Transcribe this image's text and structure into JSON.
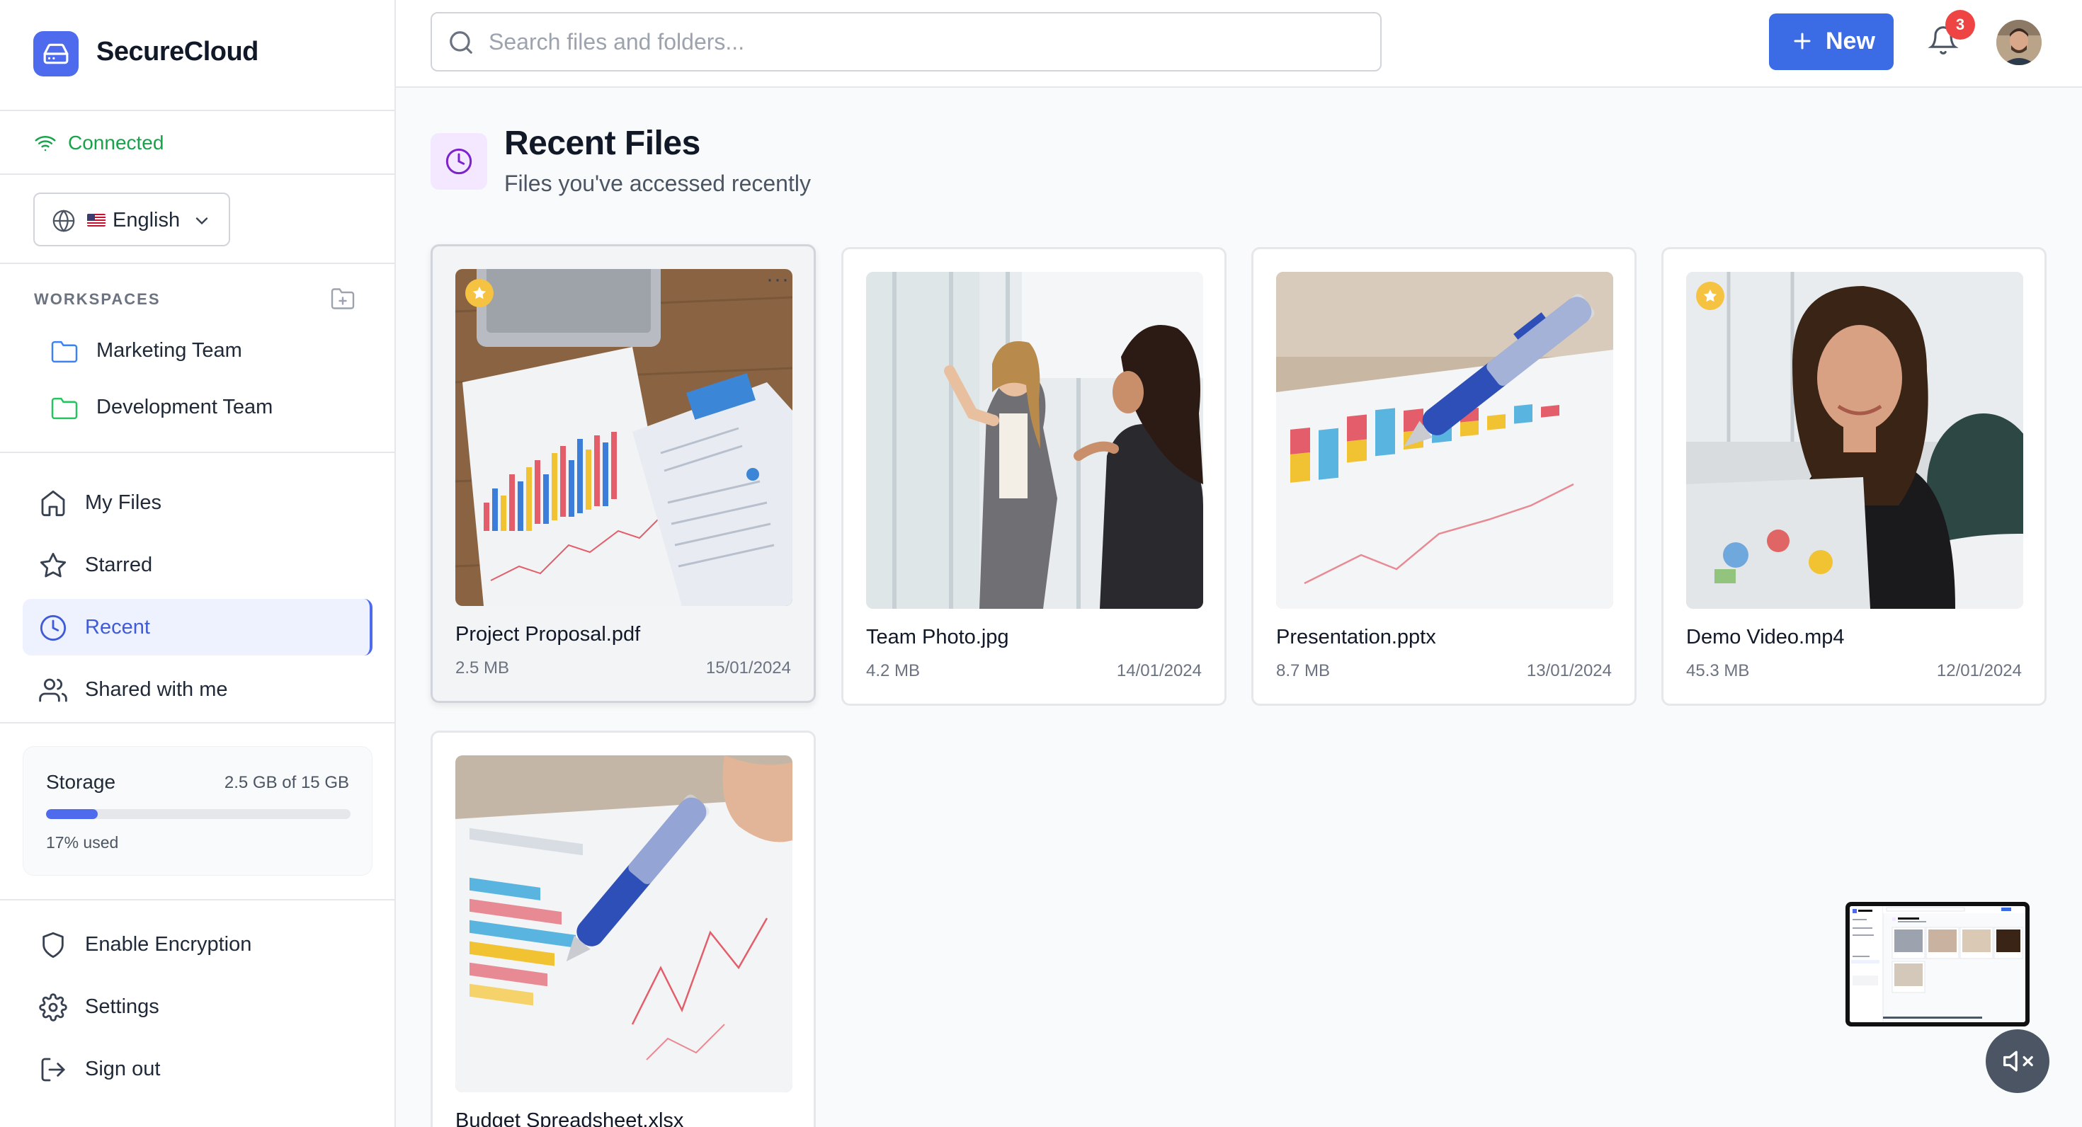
{
  "app": {
    "name": "SecureCloud"
  },
  "connection": {
    "status": "Connected"
  },
  "language": {
    "flag": "us-flag-icon",
    "selected": "English"
  },
  "workspaces": {
    "title": "WORKSPACES",
    "items": [
      {
        "label": "Marketing Team",
        "color": "#3b82f6"
      },
      {
        "label": "Development Team",
        "color": "#22c55e"
      }
    ]
  },
  "nav": {
    "items": [
      {
        "label": "My Files",
        "icon": "home-icon"
      },
      {
        "label": "Starred",
        "icon": "star-icon"
      },
      {
        "label": "Recent",
        "icon": "clock-icon",
        "active": true
      },
      {
        "label": "Shared with me",
        "icon": "users-icon"
      }
    ]
  },
  "storage": {
    "title": "Storage",
    "amount": "2.5 GB of 15 GB",
    "used_label": "17% used",
    "used_fraction": 0.17
  },
  "bottom_nav": {
    "items": [
      {
        "label": "Enable Encryption",
        "icon": "shield-icon"
      },
      {
        "label": "Settings",
        "icon": "gear-icon"
      },
      {
        "label": "Sign out",
        "icon": "sign-out-icon"
      }
    ]
  },
  "header": {
    "search_placeholder": "Search files and folders...",
    "new_label": "New",
    "notification_count": "3"
  },
  "page": {
    "title": "Recent Files",
    "subtitle": "Files you've accessed recently"
  },
  "files": [
    {
      "name": "Project Proposal.pdf",
      "size": "2.5 MB",
      "date": "15/01/2024",
      "starred": true
    },
    {
      "name": "Team Photo.jpg",
      "size": "4.2 MB",
      "date": "14/01/2024",
      "starred": false
    },
    {
      "name": "Presentation.pptx",
      "size": "8.7 MB",
      "date": "13/01/2024",
      "starred": false
    },
    {
      "name": "Demo Video.mp4",
      "size": "45.3 MB",
      "date": "12/01/2024",
      "starred": true
    },
    {
      "name": "Budget Spreadsheet.xlsx",
      "size": "",
      "date": "",
      "starred": false
    }
  ],
  "colors": {
    "accent": "#4f6bed",
    "connected": "#16a34a",
    "badge": "#ef4444",
    "star": "#f5c242"
  }
}
